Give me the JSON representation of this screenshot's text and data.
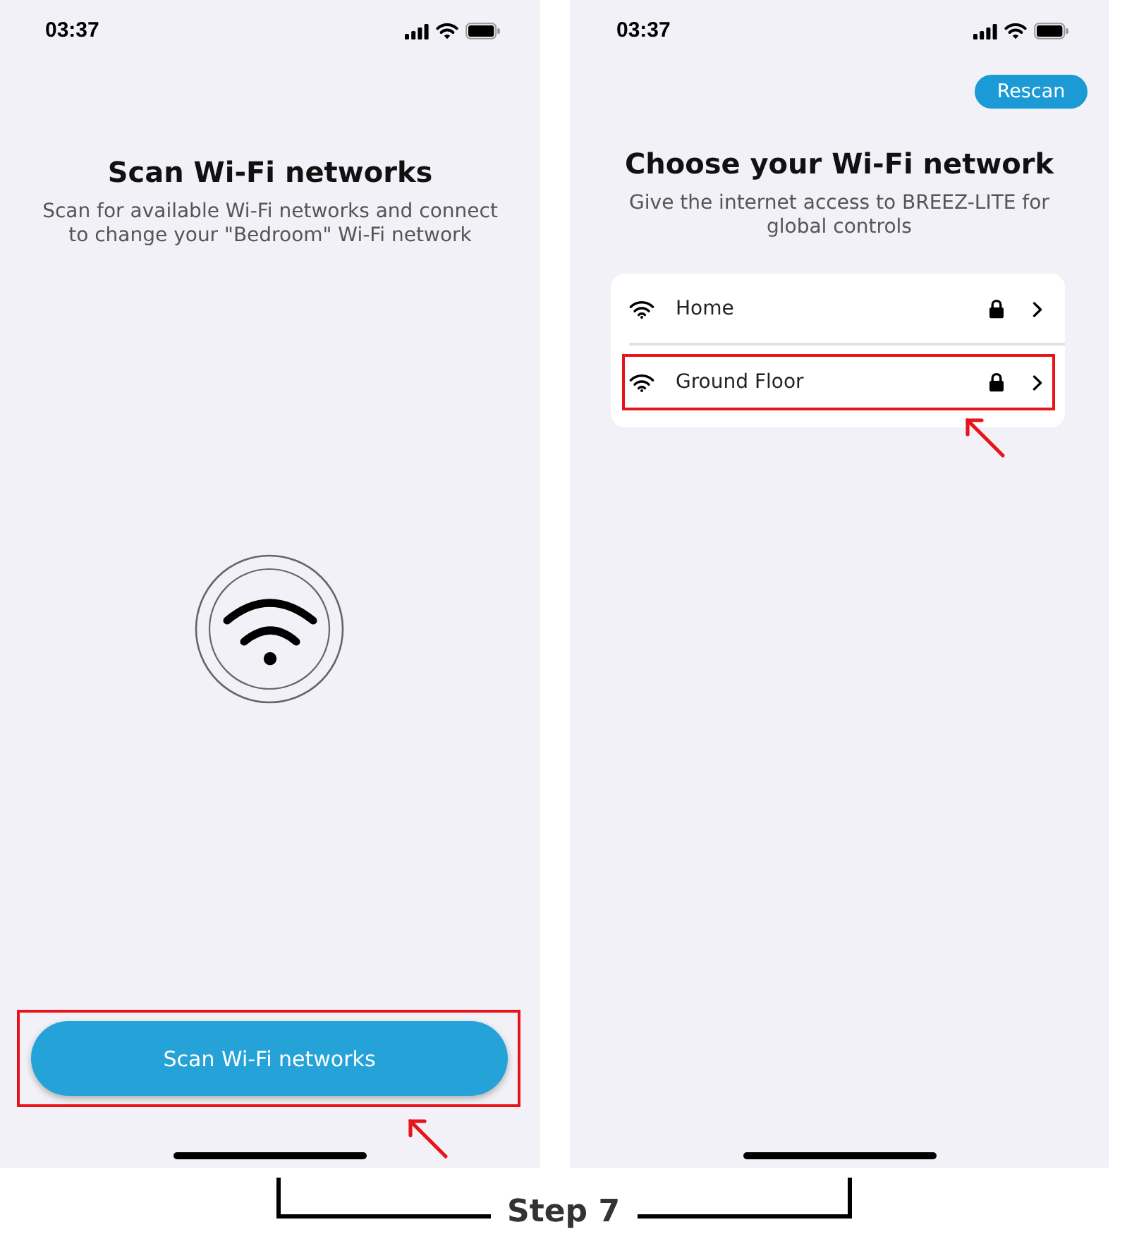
{
  "scan_screen": {
    "status_bar": {
      "time": "03:37"
    },
    "title": "Scan Wi-Fi networks",
    "subtitle": "Scan for available Wi-Fi networks and connect to change your \"Bedroom\" Wi-Fi network",
    "scan_button": {
      "label": "Scan Wi-Fi networks",
      "highlighted": true
    }
  },
  "network_list_screen": {
    "status_bar": {
      "time": "03:37"
    },
    "rescan_button": {
      "label": "Rescan"
    },
    "title": "Choose your Wi-Fi network",
    "subtitle": "Give the internet access to BREEZ-LITE for global controls",
    "networks": [
      {
        "name": "Home",
        "locked": true,
        "highlighted": false
      },
      {
        "name": "Ground Floor",
        "locked": true,
        "highlighted": true
      }
    ]
  },
  "step_label": "Step 7"
}
